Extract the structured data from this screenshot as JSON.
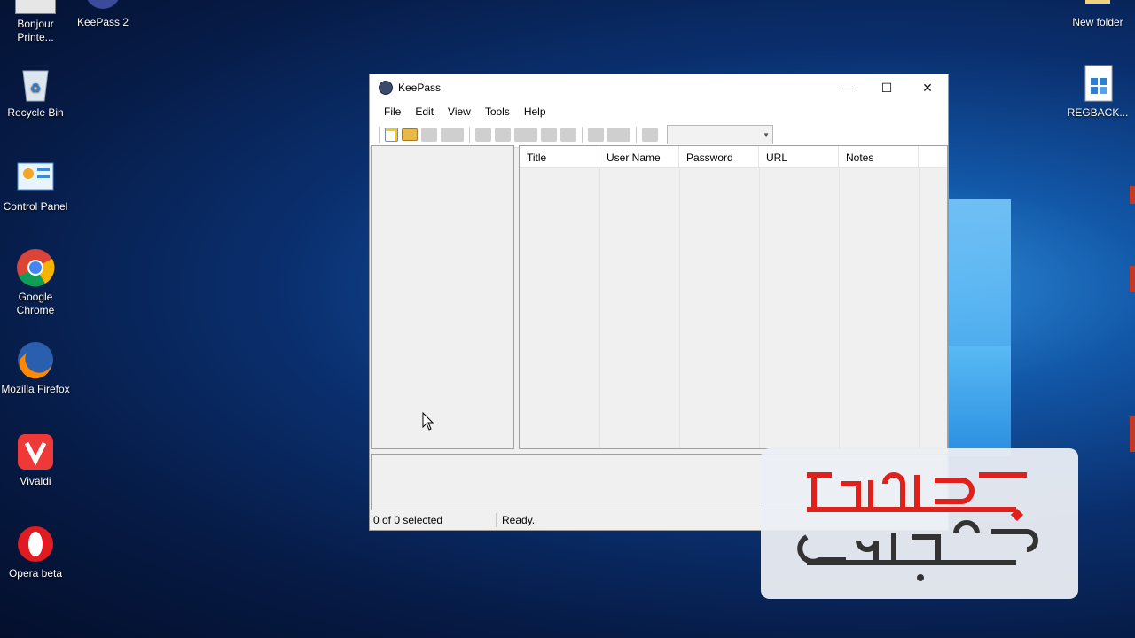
{
  "desktop": {
    "icons": [
      {
        "label": "Bonjour Printe...",
        "name": "bonjour-printer-icon"
      },
      {
        "label": "KeePass 2",
        "name": "keepass-icon"
      },
      {
        "label": "Recycle Bin",
        "name": "recycle-bin-icon"
      },
      {
        "label": "Control Panel",
        "name": "control-panel-icon"
      },
      {
        "label": "Google Chrome",
        "name": "chrome-icon"
      },
      {
        "label": "Mozilla Firefox",
        "name": "firefox-icon"
      },
      {
        "label": "Vivaldi",
        "name": "vivaldi-icon"
      },
      {
        "label": "Opera beta",
        "name": "opera-icon"
      },
      {
        "label": "New folder",
        "name": "folder-icon"
      },
      {
        "label": "REGBACK...",
        "name": "regback-icon"
      }
    ]
  },
  "window": {
    "title": "KeePass",
    "controls": {
      "minimize": "—",
      "maximize": "☐",
      "close": "✕"
    },
    "menu": [
      "File",
      "Edit",
      "View",
      "Tools",
      "Help"
    ],
    "columns": [
      "Title",
      "User Name",
      "Password",
      "URL",
      "Notes"
    ],
    "status": {
      "selection": "0 of 0 selected",
      "state": "Ready."
    }
  },
  "colors": {
    "accent": "#e0201a",
    "watermark_dark": "#333333"
  }
}
